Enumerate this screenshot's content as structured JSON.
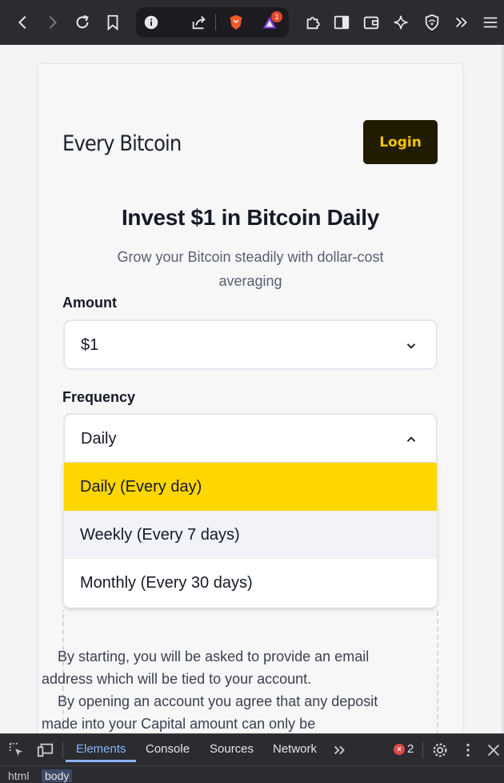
{
  "browser": {
    "back_icon": "chevron-left-icon",
    "forward_icon": "chevron-right-icon",
    "reload_icon": "reload-icon",
    "bookmark_icon": "bookmark-icon",
    "info_icon": "info-icon",
    "share_icon": "share-icon",
    "brave_icon": "brave-shield-icon",
    "rewards_icon": "brave-rewards-icon",
    "rewards_badge": "1",
    "extensions_icon": "puzzle-icon",
    "sidebar_icon": "sidebar-icon",
    "wallet_icon": "wallet-icon",
    "leo_icon": "sparkle-icon",
    "vpn_icon": "vpn-shield-icon",
    "more_icon": "double-chevron-icon",
    "menu_icon": "hamburger-icon"
  },
  "header": {
    "brand": "Every Bitcoin",
    "login_label": "Login"
  },
  "hero": {
    "title": "Invest $1 in Bitcoin Daily",
    "subtitle": "Grow your Bitcoin steadily with dollar-cost averaging"
  },
  "form": {
    "amount_label": "Amount",
    "amount_value": "$1",
    "frequency_label": "Frequency",
    "frequency_value": "Daily",
    "frequency_options": [
      "Daily (Every day)",
      "Weekly (Every 7 days)",
      "Monthly (Every 30 days)"
    ]
  },
  "notice": {
    "line1": "By starting, you will be asked to provide an email address which will be tied to your account.",
    "line2": "By opening an account you agree that any deposit made into your Capital amount can only be"
  },
  "devtools": {
    "tabs": [
      "Elements",
      "Console",
      "Sources",
      "Network"
    ],
    "error_count": "2",
    "breadcrumbs": [
      "html",
      "body"
    ]
  },
  "colors": {
    "accent": "#ffd600",
    "login_bg": "#211c00",
    "login_text": "#f5c400"
  }
}
